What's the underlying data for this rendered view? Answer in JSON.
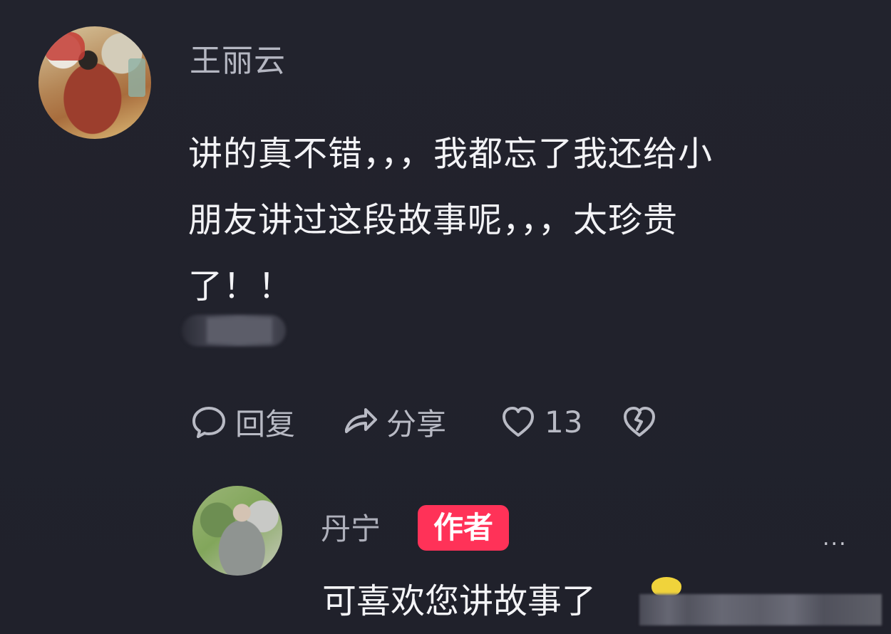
{
  "comment": {
    "username": "王丽云",
    "text_lines": [
      "讲的真不错，，，我都忘了我还给小",
      "朋友讲过这段故事呢，，，太珍贵",
      "了！！"
    ]
  },
  "actions": {
    "reply_label": "回复",
    "share_label": "分享",
    "like_count": "13"
  },
  "reply": {
    "username": "丹宁",
    "badge": "作者",
    "text": "可喜欢您讲故事了",
    "more": "..."
  },
  "colors": {
    "background": "#21222c",
    "badge": "#ff3258",
    "muted_text": "#b5b7c2",
    "main_text": "#f3f3f6"
  },
  "icons": {
    "reply": "reply-icon",
    "share": "share-icon",
    "like": "heart-icon",
    "dislike": "broken-heart-icon",
    "more": "more-icon"
  }
}
